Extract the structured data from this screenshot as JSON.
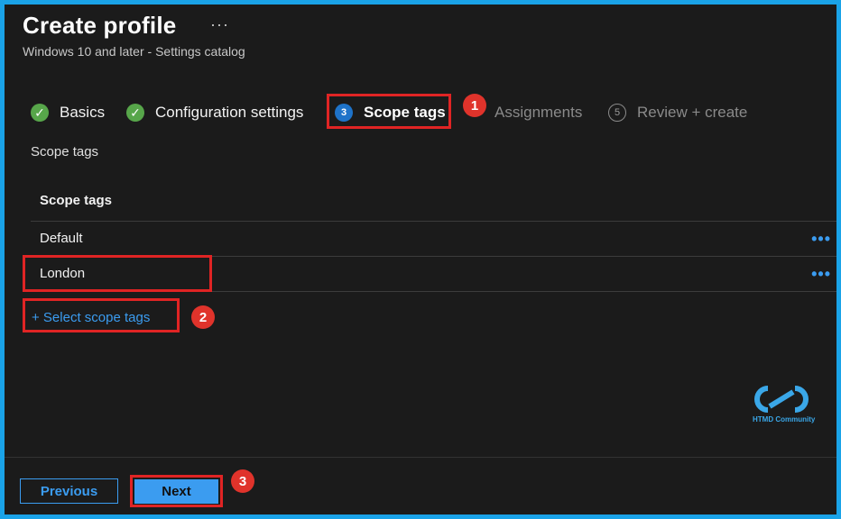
{
  "header": {
    "title": "Create profile",
    "more_label": "···",
    "subtitle": "Windows 10 and later - Settings catalog"
  },
  "steps": [
    {
      "label": "Basics",
      "state": "completed",
      "icon": "check-icon"
    },
    {
      "label": "Configuration settings",
      "state": "completed",
      "icon": "check-icon"
    },
    {
      "label": "Scope tags",
      "state": "active",
      "number": "3"
    },
    {
      "label": "Assignments",
      "state": "inactive",
      "number": ""
    },
    {
      "label": "Review + create",
      "state": "inactive",
      "number": "5"
    }
  ],
  "section": {
    "label": "Scope tags"
  },
  "table": {
    "header": "Scope tags",
    "rows": [
      {
        "name": "Default",
        "more": "•••"
      },
      {
        "name": "London",
        "more": "•••"
      }
    ]
  },
  "select_link": "+ Select scope tags",
  "annotations": [
    "1",
    "2",
    "3"
  ],
  "logo": {
    "text": "HTMD Community"
  },
  "footer": {
    "previous_label": "Previous",
    "next_label": "Next"
  },
  "colors": {
    "accent": "#3b9cf0",
    "highlight": "#e02424",
    "success": "#57a64a",
    "background": "#1b1b1b",
    "frame": "#1aa3e8"
  }
}
